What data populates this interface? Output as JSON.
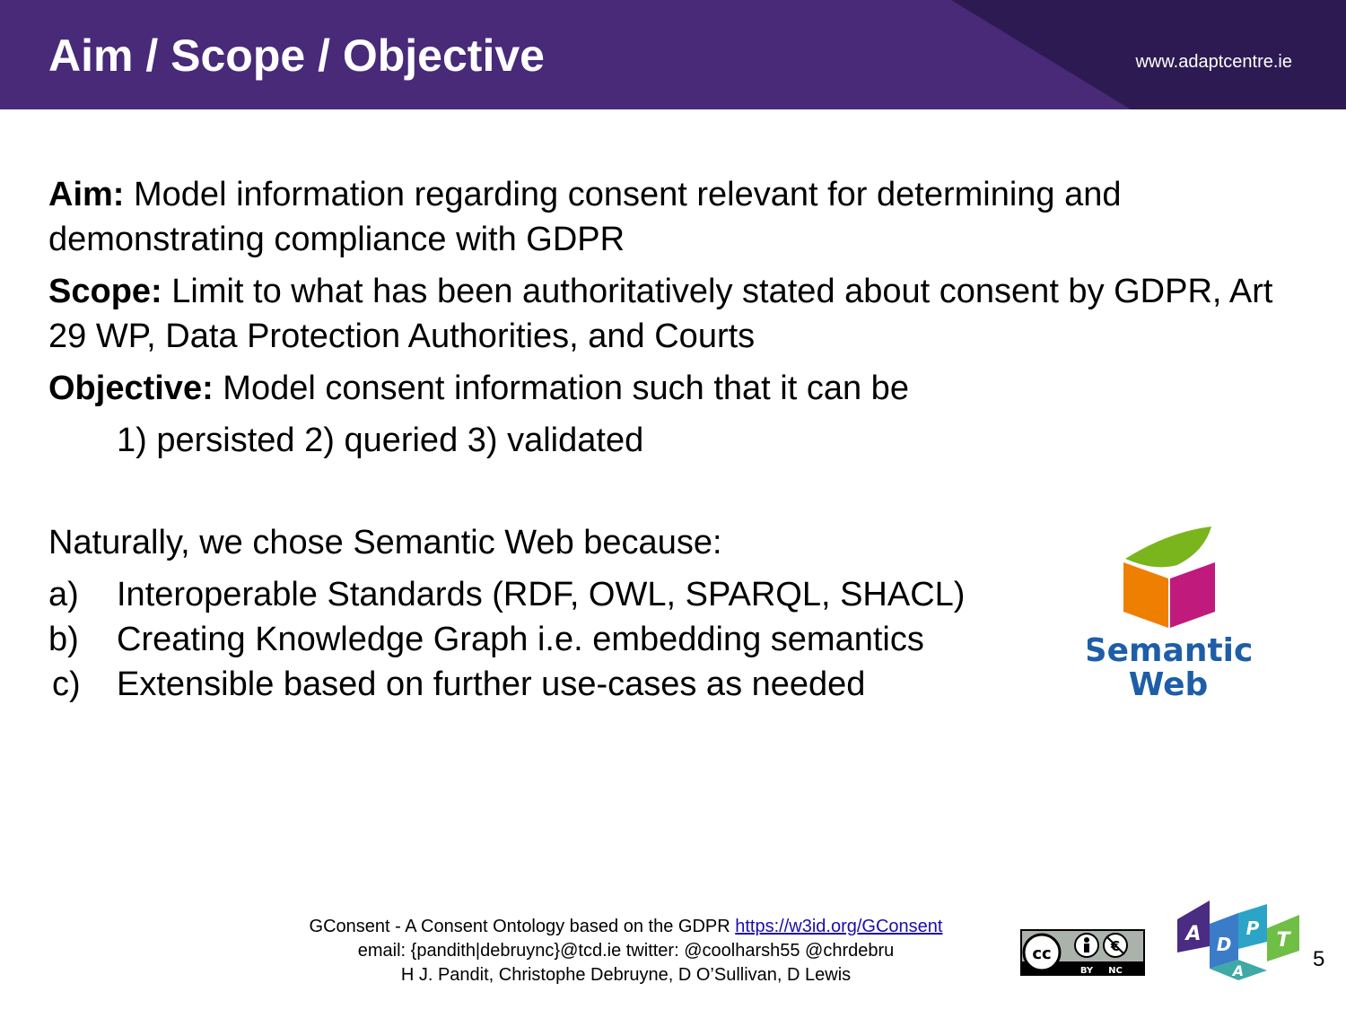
{
  "header": {
    "title": "Aim / Scope / Objective",
    "website": "www.adaptcentre.ie"
  },
  "content": {
    "aim_label": "Aim:",
    "aim_text": " Model information regarding consent relevant for determining and demonstrating compliance with GDPR",
    "scope_label": "Scope:",
    "scope_text": " Limit to what has been authoritatively stated about consent by GDPR, Art 29 WP, Data Protection Authorities, and Courts",
    "objective_label": "Objective:",
    "objective_text": " Model consent information such that it can be",
    "objective_items": "1) persisted  2) queried  3) validated",
    "naturally": "Naturally, we chose Semantic Web because:",
    "reasons": [
      {
        "marker": "a)",
        "text": "Interoperable Standards (RDF, OWL, SPARQL, SHACL)"
      },
      {
        "marker": "b)",
        "text": "Creating Knowledge Graph i.e. embedding semantics"
      },
      {
        "marker": "c)",
        "text": "Extensible based on further use-cases as needed"
      }
    ]
  },
  "logo": {
    "semantic_web_line1": "Semantic",
    "semantic_web_line2": "Web"
  },
  "footer": {
    "line1_text": "GConsent - A Consent Ontology based on the GDPR ",
    "line1_link": "https://w3id.org/GConsent",
    "line2": "email: {pandith|debruync}@tcd.ie twitter: @coolharsh55 @chrdebru",
    "line3": "H J. Pandit, Christophe Debruyne, D O’Sullivan, D Lewis"
  },
  "license": {
    "by": "BY",
    "nc": "NC"
  },
  "adapt_letters": [
    "A",
    "D",
    "P",
    "A",
    "T"
  ],
  "page_number": "5",
  "colors": {
    "header_bg": "#482a78",
    "header_dark": "#2e1a52",
    "sw_green": "#7ab51d",
    "sw_orange": "#ee7f00",
    "sw_magenta": "#c01a7d",
    "sw_text": "#1e5ea8"
  }
}
